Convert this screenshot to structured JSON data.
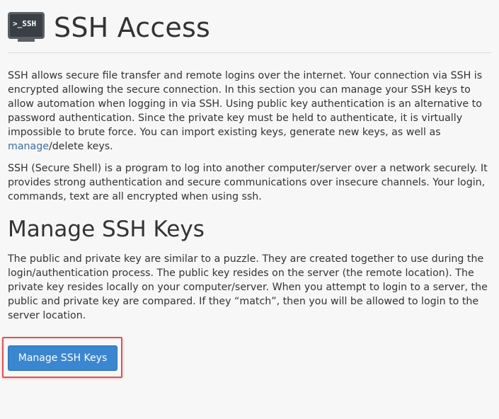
{
  "header": {
    "icon_text": ">_SSH",
    "icon": "terminal-ssh-icon",
    "title": "SSH Access"
  },
  "intro": {
    "text_before_link": "SSH allows secure file transfer and remote logins over the internet. Your connection via SSH is encrypted allowing the secure connection. In this section you can manage your SSH keys to allow automation when logging in via SSH. Using public key authentication is an alternative to password authentication. Since the private key must be held to authenticate, it is virtually impossible to brute force. You can import existing keys, generate new keys, as well as ",
    "link_text": "manage",
    "text_after_link": "/delete keys."
  },
  "about": {
    "text": "SSH (Secure Shell) is a program to log into another computer/server over a network securely. It provides strong authentication and secure communications over insecure channels. Your login, commands, text are all encrypted when using ssh."
  },
  "manage_section": {
    "title": "Manage SSH Keys",
    "description": "The public and private key are similar to a puzzle. They are created together to use during the login/authentication process. The public key resides on the server (the remote location). The private key resides locally on your computer/server. When you attempt to login to a server, the public and private key are compared. If they “match”, then you will be allowed to login to the server location.",
    "button_label": "Manage SSH Keys"
  },
  "colors": {
    "background": "#f7f7f7",
    "text": "#333333",
    "link": "#3d6fa5",
    "button": "#3a86d1",
    "highlight_border": "#e05252"
  }
}
